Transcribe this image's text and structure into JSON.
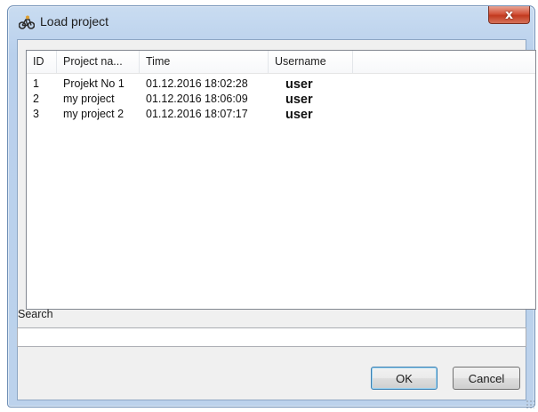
{
  "window": {
    "title": "Load project",
    "close_glyph": "x"
  },
  "list": {
    "columns": [
      "ID",
      "Project na...",
      "Time",
      "Username"
    ],
    "rows": [
      {
        "id": "1",
        "name": "Projekt No 1",
        "time": "01.12.2016 18:02:28",
        "user": "user"
      },
      {
        "id": "2",
        "name": "my project",
        "time": "01.12.2016 18:06:09",
        "user": "user"
      },
      {
        "id": "3",
        "name": "my project 2",
        "time": "01.12.2016 18:07:17",
        "user": "user"
      }
    ]
  },
  "search": {
    "label": "Search",
    "value": ""
  },
  "buttons": {
    "ok": "OK",
    "cancel": "Cancel"
  },
  "icons": {
    "app": "project-bike-icon",
    "close": "close-icon",
    "grip": "resize-grip-icon"
  },
  "colors": {
    "frame": "#b9d0ec",
    "close_button": "#c94a30",
    "default_button_border": "#3c7fb1"
  }
}
